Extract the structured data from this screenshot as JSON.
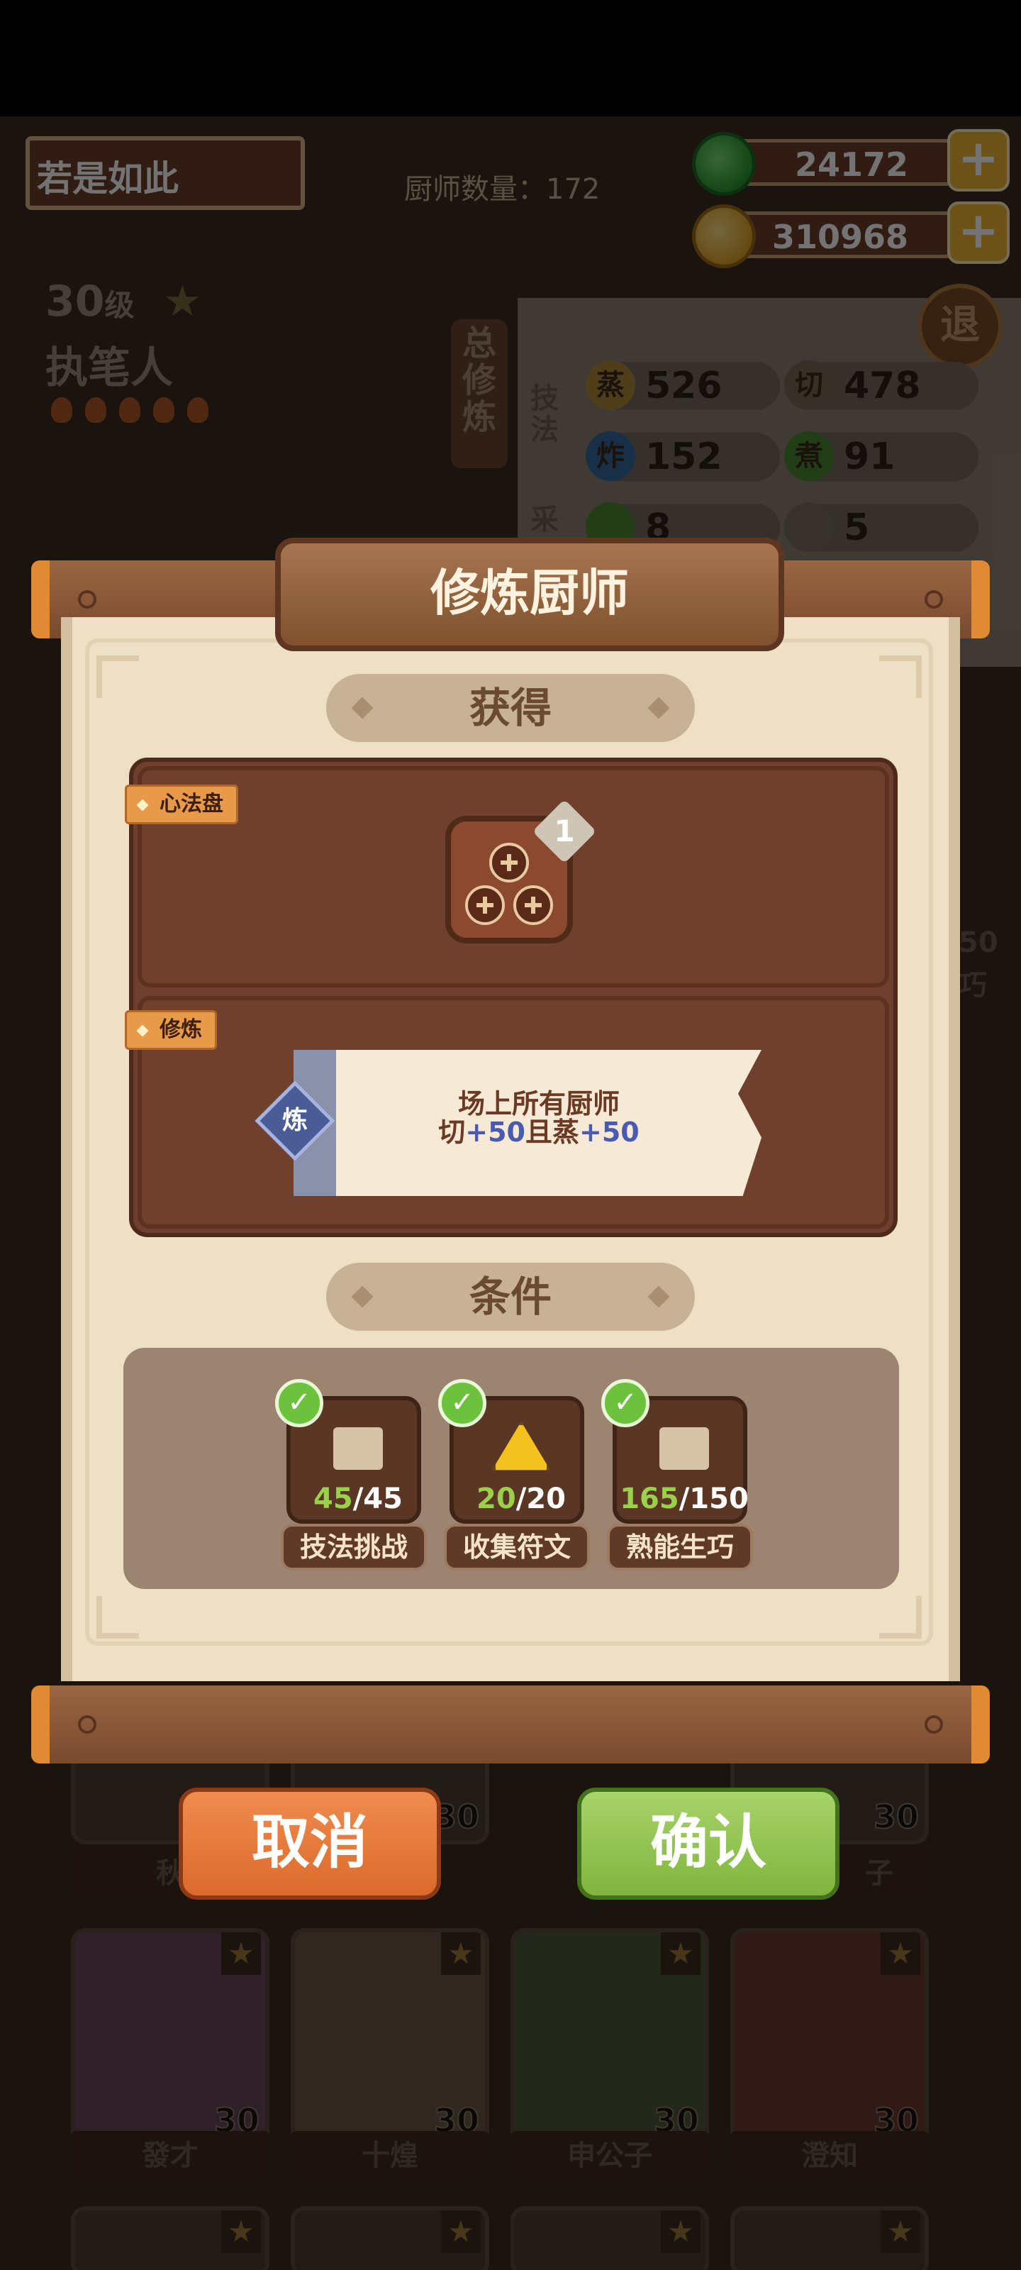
{
  "header": {
    "player_name": "若是如此",
    "chef_count_label": "厨师数量：",
    "chef_count": "172",
    "jade": "24172",
    "coins": "310968",
    "plus": "+"
  },
  "profile": {
    "level_number": "30",
    "level_suffix": "级",
    "title": "执笔人"
  },
  "side_tab": {
    "label": "总修炼"
  },
  "skills_panel": {
    "tech_label": "技法",
    "collect_label": "采",
    "exit_label": "退",
    "skills": [
      {
        "icon": "蒸",
        "value": "526",
        "color": "#c79a3a"
      },
      {
        "icon": "切",
        "value": "478",
        "color": "#8a7a5c"
      },
      {
        "icon": "炸",
        "value": "152",
        "color": "#3d7ab8"
      },
      {
        "icon": "煮",
        "value": "91",
        "color": "#4e9a3a"
      },
      {
        "icon": "",
        "value": "8",
        "color": "#5a9a3a"
      },
      {
        "icon": "",
        "value": "5",
        "color": "#8a8070"
      }
    ],
    "partial": [
      "50",
      "巧"
    ]
  },
  "modal": {
    "title": "修炼厨师",
    "gain_header": "获得",
    "xinfa_tag": "心法盘",
    "xinfa_count": "1",
    "practice_tag": "修炼",
    "practice_badge": "炼",
    "desc_line1": "场上所有厨师",
    "desc_cut": "切",
    "desc_cut_val": "+50",
    "desc_and": "且蒸",
    "desc_steam_val": "+50",
    "cond_header": "条件",
    "conditions": [
      {
        "done": "45",
        "total": "/45",
        "label": "技法挑战"
      },
      {
        "done": "20",
        "total": "/20",
        "label": "收集符文"
      },
      {
        "done": "165",
        "total": "/150",
        "label": "熟能生巧"
      }
    ],
    "cancel": "取消",
    "confirm": "确认"
  },
  "chef_cards": {
    "row1_names": [
      "秋",
      "子"
    ],
    "row2": [
      {
        "name": "發才",
        "level": "30"
      },
      {
        "name": "十煌",
        "level": "30"
      },
      {
        "name": "申公子",
        "level": "30"
      },
      {
        "name": "澄知",
        "level": "30"
      }
    ],
    "row1_levels": [
      "30",
      "30",
      "30"
    ],
    "star": "★"
  },
  "colors": {
    "accent_orange": "#db6a2c",
    "accent_green": "#7fb43e",
    "highlight_blue": "#4a5ab0",
    "check_green": "#6cc23c"
  }
}
